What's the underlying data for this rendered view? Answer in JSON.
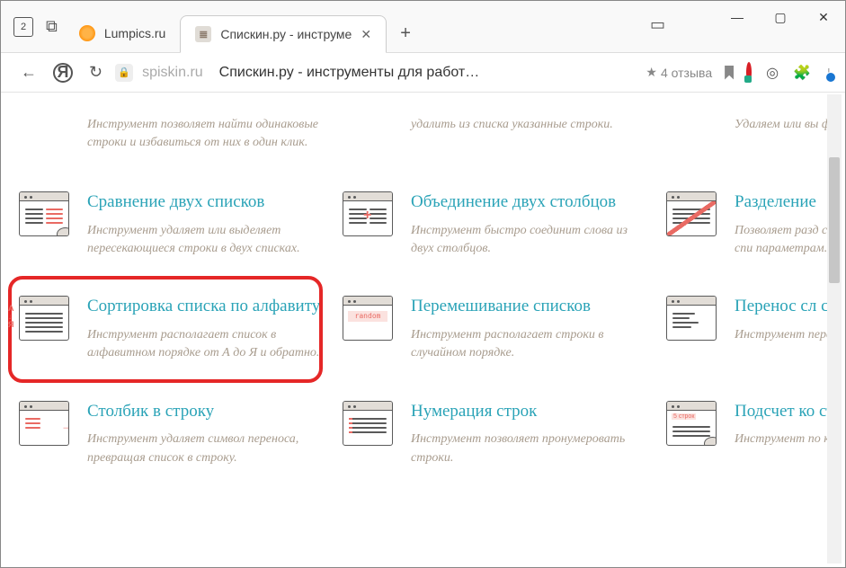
{
  "browser": {
    "home_badge": "2",
    "tabs": [
      {
        "label": "Lumpics.ru"
      },
      {
        "label": "Спискин.ру - инструме"
      }
    ],
    "add_tab": "+",
    "win": {
      "min": "—",
      "max": "▢",
      "close": "✕"
    }
  },
  "address": {
    "back": "←",
    "reload": "↻",
    "y_label": "Я",
    "domain": "spiskin.ru",
    "title": "Спискин.ру - инструменты для работ…",
    "rating_star": "★",
    "rating_text": "4 отзыва"
  },
  "cards": {
    "r0c0": {
      "desc": "Инструмент позволяет найти одинаковые строки и избавиться от них в один клик."
    },
    "r0c1": {
      "desc": "удалить из списка указанные строки."
    },
    "r0c2": {
      "desc": "Удаляем или вы фразы, где встр слова."
    },
    "r1c0": {
      "title": "Сравнение двух списков",
      "desc": "Инструмент удаляет или выделяет пересекающиеся строки в двух списках."
    },
    "r1c1": {
      "title": "Объединение двух столбцов",
      "desc": "Инструмент быстро соединит слова из двух столбцов."
    },
    "r1c2": {
      "title": "Разделение",
      "desc": "Позволяет разд списке на два и отдельных спи параметрам."
    },
    "r2c0": {
      "title": "Сортировка списка по алфавиту",
      "desc": "Инструмент располагает список в алфавитном порядке от А до Я и обратно."
    },
    "r2c1": {
      "title": "Перемешивание списков",
      "desc": "Инструмент располагает строки в случайном порядке."
    },
    "r2c2": {
      "title": "Перенос сл столбик",
      "desc": "Инструмент переносить спи строку в стр"
    },
    "r3c0": {
      "title": "Столбик в строку",
      "desc": "Инструмент удаляет символ переноса, превращая список в строку."
    },
    "r3c1": {
      "title": "Нумерация строк",
      "desc": "Инструмент позволяет пронумеровать строки."
    },
    "r3c2": {
      "title": "Подсчет ко строк",
      "desc": "Инструмент по количество стр списке."
    },
    "random_label": "random",
    "five_label": "5 строк"
  }
}
